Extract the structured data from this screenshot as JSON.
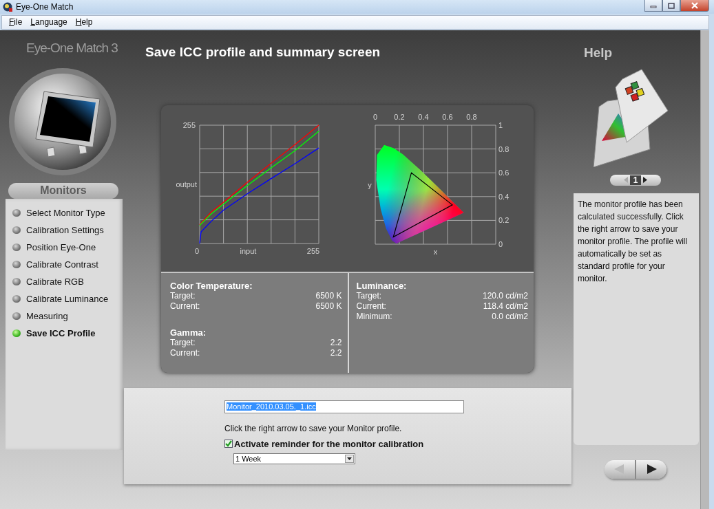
{
  "window": {
    "title": "Eye-One Match"
  },
  "menu": [
    "File",
    "Language",
    "Help"
  ],
  "sidebar": {
    "logo": "Eye-One Match 3",
    "section": "Monitors",
    "steps": [
      {
        "label": "Select Monitor Type",
        "selected": false
      },
      {
        "label": "Calibration Settings",
        "selected": false
      },
      {
        "label": "Position Eye-One",
        "selected": false
      },
      {
        "label": "Calibrate Contrast",
        "selected": false
      },
      {
        "label": "Calibrate RGB",
        "selected": false
      },
      {
        "label": "Calibrate Luminance",
        "selected": false
      },
      {
        "label": "Measuring",
        "selected": false
      },
      {
        "label": "Save ICC Profile",
        "selected": true
      }
    ]
  },
  "page": {
    "title": "Save ICC profile and summary screen"
  },
  "gamma_chart": {
    "y_max_label": "255",
    "y_title": "output",
    "x_min_label": "0",
    "x_title": "input",
    "x_max_label": "255"
  },
  "gamut_chart": {
    "x_tick_labels": [
      "0",
      "0.2",
      "0.4",
      "0.6",
      "0.8"
    ],
    "y_tick_labels": [
      "1",
      "0.8",
      "0.6",
      "0.4",
      "0.2",
      "0"
    ],
    "x_title": "x",
    "y_title": "y"
  },
  "summary": {
    "columns": [
      [
        {
          "heading": "Color Temperature:",
          "rows": [
            {
              "label": "Target:",
              "value": "6500 K"
            },
            {
              "label": "Current:",
              "value": "6500 K"
            }
          ]
        },
        {
          "heading": "Gamma:",
          "rows": [
            {
              "label": "Target:",
              "value": "2.2"
            },
            {
              "label": "Current:",
              "value": "2.2"
            }
          ]
        }
      ],
      [
        {
          "heading": "Luminance:",
          "rows": [
            {
              "label": "Target:",
              "value": "120.0 cd/m2"
            },
            {
              "label": "Current:",
              "value": "118.4 cd/m2"
            },
            {
              "label": "Minimum:",
              "value": "0.0 cd/m2"
            }
          ]
        }
      ]
    ]
  },
  "save": {
    "filename": "Monitor_2010.03.05._1.icc",
    "filename_selected": true,
    "instruction": "Click the right arrow to save your Monitor profile.",
    "reminder": {
      "label": "Activate reminder for the monitor calibration",
      "checked": true
    },
    "interval": {
      "value": "1 Week"
    }
  },
  "help": {
    "title": "Help",
    "page": "1",
    "text": "The monitor profile has been calculated successfully. Click the right arrow to save your monitor profile. The profile will automatically be set as standard profile for your monitor."
  }
}
